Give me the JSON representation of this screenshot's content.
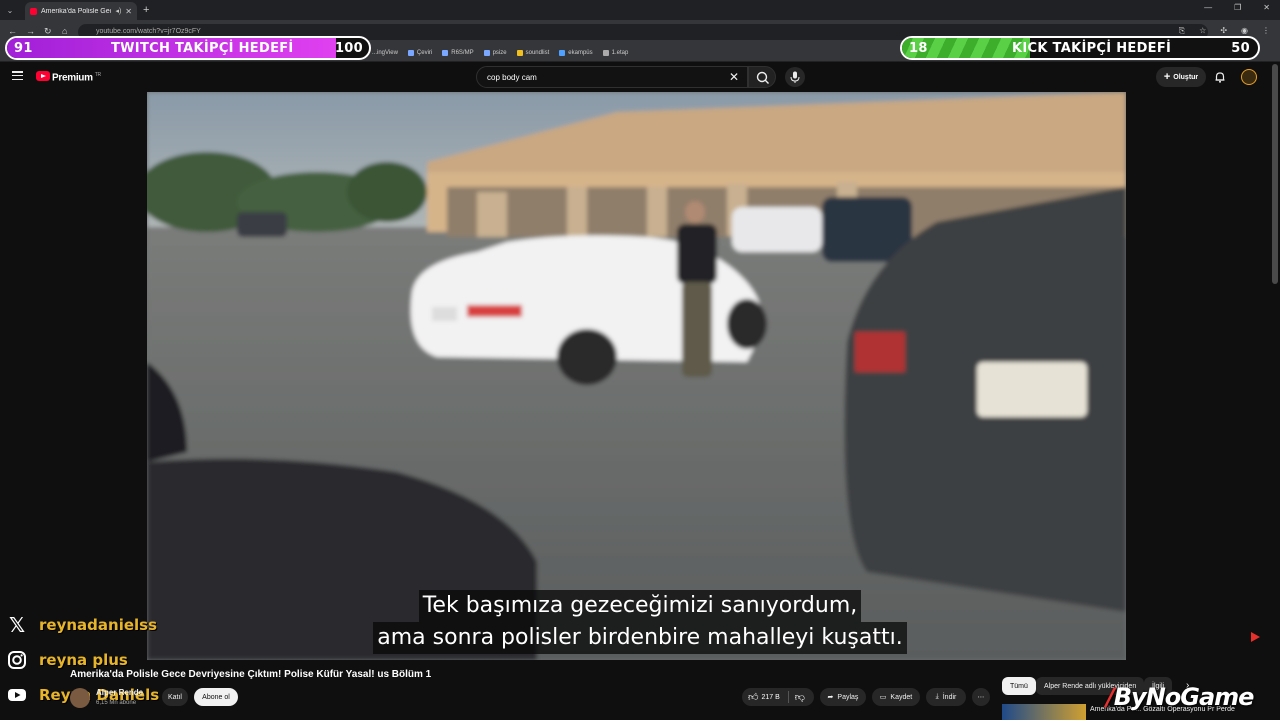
{
  "browser": {
    "tab_title": "Amerika'da Polisle Gece Dev",
    "new_tab": "+",
    "url": "youtube.com/watch?v=jr7Oz9cFY",
    "bookmarks": [
      {
        "label": "...ingView"
      },
      {
        "label": "Çeviri"
      },
      {
        "label": "R6S/MP"
      },
      {
        "label": "psize"
      },
      {
        "label": "soundlist"
      },
      {
        "label": "ekampüs"
      },
      {
        "label": "1.etap"
      }
    ]
  },
  "overlays": {
    "twitch_goal": {
      "current": "91",
      "label": "TWITCH TAKİPÇİ HEDEFİ",
      "target": "100",
      "progress": 0.91
    },
    "kick_goal": {
      "current": "18",
      "label": "KICK TAKİPÇİ HEDEFİ",
      "target": "50",
      "progress": 0.36
    },
    "socials": [
      {
        "icon": "x-icon",
        "handle": "reynadanielss"
      },
      {
        "icon": "instagram-icon",
        "handle": "reyna plus"
      },
      {
        "icon": "youtube-icon",
        "handle": "Reyna Daniels"
      }
    ],
    "sponsor": "ByNoGame"
  },
  "youtube": {
    "brand": "Premium",
    "brand_sup": "TR",
    "search_query": "cop body cam",
    "create_label": "Oluştur"
  },
  "video": {
    "subtitles": [
      "Tek başımıza gezeceğimizi sanıyordum,",
      "ama sonra polisler birdenbire mahalleyi kuşattı."
    ],
    "title": "Amerika'da Polisle Gece Devriyesine Çıktım! Polise Küfür Yasal! us Bölüm 1",
    "channel": "Alper Rende",
    "subscribers": "6,15 Mn abone",
    "join_label": "Katıl",
    "subscribe_label": "Abone ol",
    "likes": "217 B",
    "share_label": "Paylaş",
    "save_label": "Kaydet",
    "download_label": "İndir"
  },
  "sidebar_chips": {
    "all": "Tümü",
    "uploads": "Alper Rende adlı yükleyiciden",
    "related": "İlgili",
    "rec_title": "Amerika'da Po... Gözaltı Operasyonu Pr Perde"
  }
}
